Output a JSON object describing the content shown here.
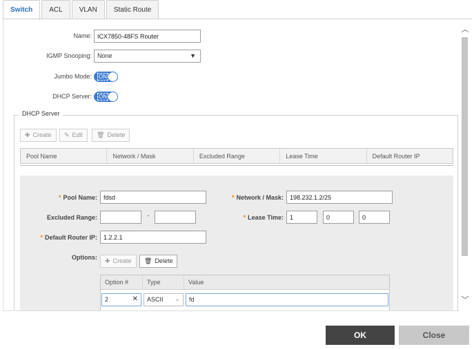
{
  "tabs": [
    {
      "label": "Switch",
      "active": true
    },
    {
      "label": "ACL",
      "active": false
    },
    {
      "label": "VLAN",
      "active": false
    },
    {
      "label": "Static Route",
      "active": false
    }
  ],
  "switch_form": {
    "name_label": "Name:",
    "name_value": "ICX7850-48FS Router",
    "igmp_label": "IGMP Snooping:",
    "igmp_value": "None",
    "jumbo_label": "Jumbo Mode:",
    "jumbo_state": "ON",
    "dhcp_label": "DHCP Server:",
    "dhcp_state": "ON"
  },
  "dhcp_server": {
    "legend": "DHCP Server",
    "toolbar": {
      "create": "Create",
      "edit": "Edit",
      "delete": "Delete"
    },
    "columns": [
      "Pool Name",
      "Network / Mask",
      "Excluded Range",
      "Lease Time",
      "Default Router IP"
    ]
  },
  "pool_form": {
    "pool_name_label": "Pool Name:",
    "pool_name_value": "fdsd",
    "network_label": "Network / Mask:",
    "network_value": "198.232.1.2/25",
    "excluded_label": "Excluded Range:",
    "excluded_from": "",
    "excluded_sep": "-",
    "excluded_to": "",
    "lease_label": "Lease Time:",
    "lease_days": "1",
    "lease_hours": "0",
    "lease_minutes": "0",
    "router_label": "Default Router IP:",
    "router_value": "1.2.2.1",
    "options_label": "Options:",
    "options_create": "Create",
    "options_delete": "Delete",
    "option_columns": [
      "Option #",
      "Type",
      "Value"
    ],
    "option_row": {
      "option": "2",
      "type": "ASCII",
      "value": "fd"
    }
  },
  "footer": {
    "ok": "OK",
    "close": "Close"
  },
  "colors": {
    "accent": "#2a6ebb",
    "toggle": "#3c7bd0",
    "required": "#e8851c",
    "ok_bg": "#444444",
    "close_bg": "#c8c8c8"
  }
}
